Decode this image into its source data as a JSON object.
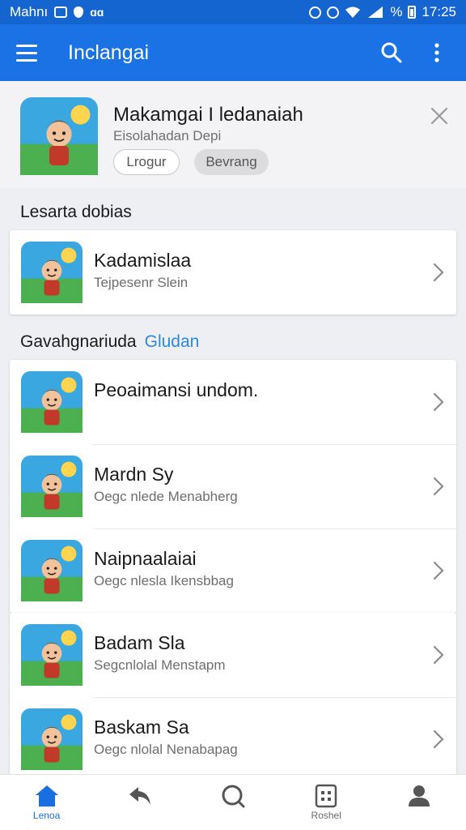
{
  "status_bar": {
    "carrier": "Mahnı",
    "time": "17:25",
    "battery": "%"
  },
  "app_bar": {
    "title": "Inclangai",
    "menu_icon": "hamburger-menu-icon",
    "search_icon": "search-icon",
    "more_icon": "more-vert-icon"
  },
  "banner": {
    "title": "Makamgai I ledanaiah",
    "subtitle": "Eisolahadan Depi",
    "button_outline": "Lrogur",
    "button_filled": "Bevrang",
    "close_icon": "close-icon"
  },
  "section_recent": {
    "title": "Lesarta dobias",
    "items": [
      {
        "title": "Kadamislaa",
        "subtitle": "Tejpesenr Slein",
        "thumb": "game-thumb-1"
      }
    ]
  },
  "section_more": {
    "title": "Gavahgnariuda",
    "link": "Gludan",
    "items": [
      {
        "title": "Peoaimansi undom.",
        "subtitle": "",
        "thumb": "game-thumb-2"
      },
      {
        "title": "Mardn Sy",
        "subtitle": "Oegc nlede Menabherg",
        "thumb": "game-thumb-3"
      },
      {
        "title": "Naipnaalaiai",
        "subtitle": "Oegc nlesla Ikensbbag",
        "thumb": "game-thumb-4"
      }
    ]
  },
  "section_extra": {
    "items": [
      {
        "title": "Badam Sla",
        "subtitle": "Segcnlolal Menstapm",
        "thumb": "game-thumb-5"
      },
      {
        "title": "Baskam Sa",
        "subtitle": "Oegc nlolal Nenabapag",
        "thumb": "game-thumb-6"
      }
    ]
  },
  "bottom_nav": {
    "items": [
      {
        "label": "Lenoa",
        "icon": "home-icon",
        "active": true
      },
      {
        "label": "",
        "icon": "share-icon",
        "active": false
      },
      {
        "label": "",
        "icon": "search-icon",
        "active": false
      },
      {
        "label": "Roshel",
        "icon": "grid-icon",
        "active": false
      },
      {
        "label": "",
        "icon": "profile-icon",
        "active": false
      }
    ]
  },
  "colors": {
    "primary": "#1a72e4",
    "status_bar": "#1565d0",
    "accent_link": "#2b88de",
    "background": "#eeeff2"
  }
}
